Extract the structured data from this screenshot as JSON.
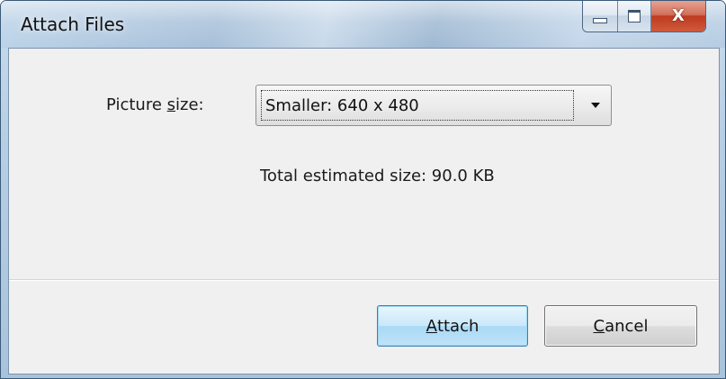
{
  "window": {
    "title": "Attach Files",
    "controls": {
      "minimize_icon": "minimize-icon",
      "maximize_icon": "maximize-icon",
      "close_icon": "close-icon",
      "close_glyph": "X"
    }
  },
  "form": {
    "picture_size_label_pre": "Picture ",
    "picture_size_label_accel": "s",
    "picture_size_label_post": "ize:",
    "picture_size_value": "Smaller: 640 x 480",
    "total_estimated_size": "Total estimated size: 90.0 KB"
  },
  "buttons": {
    "attach_accel": "A",
    "attach_rest": "ttach",
    "cancel_accel": "C",
    "cancel_rest": "ancel"
  },
  "colors": {
    "title_bar": "#b7cfe4",
    "client_bg": "#f0f0f0",
    "close_button": "#c74a2f",
    "default_button_border": "#3c7fb1"
  }
}
